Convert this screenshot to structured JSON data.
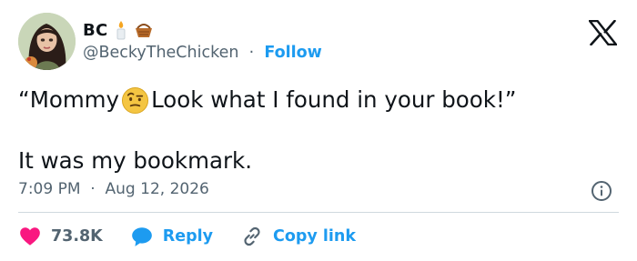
{
  "author": {
    "display_name": "BC",
    "name_emojis": [
      "candle-icon",
      "basket-icon"
    ],
    "handle": "@BeckyTheChicken",
    "separator": "·",
    "follow_label": "Follow"
  },
  "tweet": {
    "line1_before": "“Mommy",
    "line1_emoji": "face-with-raised-eyebrow-icon",
    "line1_after": "Look what I found in your book!”",
    "line2": "It was my bookmark."
  },
  "meta": {
    "time": "7:09 PM",
    "separator": "·",
    "date": "Aug 12, 2026"
  },
  "actions": {
    "like_count": "73.8K",
    "reply_label": "Reply",
    "copy_link_label": "Copy link"
  },
  "colors": {
    "accent": "#1d9bf0",
    "like": "#f91880",
    "muted_text": "#536471",
    "text": "#0f1419"
  }
}
